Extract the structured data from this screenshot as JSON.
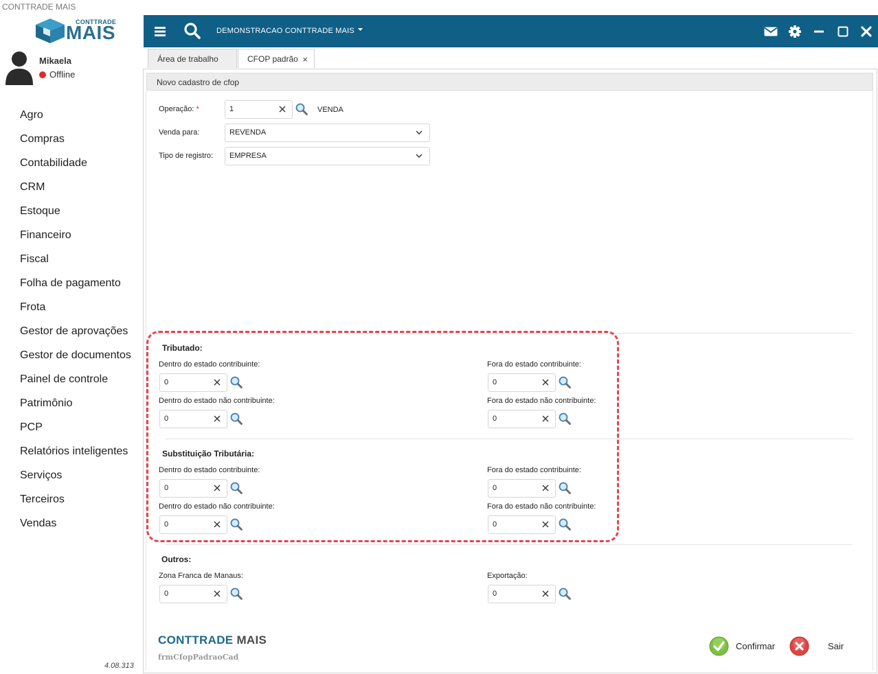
{
  "window": {
    "title": "CONTTRADE MAIS"
  },
  "logo": {
    "sup": "CONTTRADE",
    "main": "MAIS"
  },
  "user": {
    "name": "Mikaela",
    "status": "Offline",
    "status_color": "#e02a2a"
  },
  "menu": [
    "Agro",
    "Compras",
    "Contabilidade",
    "CRM",
    "Estoque",
    "Financeiro",
    "Fiscal",
    "Folha de pagamento",
    "Frota",
    "Gestor de aprovações",
    "Gestor de documentos",
    "Painel de controle",
    "Patrimônio",
    "PCP",
    "Relatórios inteligentes",
    "Serviços",
    "Terceiros",
    "Vendas"
  ],
  "version": "4.08.313",
  "topbar": {
    "company": "DEMONSTRACAO CONTTRADE MAIS",
    "color": "#0f5f86",
    "icons": [
      "menu-icon",
      "search-icon",
      "mail-icon",
      "gear-icon",
      "minimize-icon",
      "maximize-icon",
      "close-icon"
    ]
  },
  "tabs": [
    {
      "label": "Área de trabalho"
    },
    {
      "label": "CFOP padrão",
      "close": "×"
    }
  ],
  "form": {
    "header": "Novo cadastro de cfop",
    "operacao": {
      "label": "Operação:",
      "required": "*",
      "value": "1",
      "desc": "VENDA"
    },
    "venda_para": {
      "label": "Venda para:",
      "value": "REVENDA"
    },
    "tipo_registro": {
      "label": "Tipo de registro:",
      "value": "EMPRESA"
    },
    "tributado": {
      "title": "Tributado:",
      "dentro_contrib": {
        "label": "Dentro do estado contribuinte:",
        "value": "0"
      },
      "fora_contrib": {
        "label": "Fora do estado contribuinte:",
        "value": "0"
      },
      "dentro_nao_contrib": {
        "label": "Dentro do estado não contribuinte:",
        "value": "0"
      },
      "fora_nao_contrib": {
        "label": "Fora do estado não contribuinte:",
        "value": "0"
      }
    },
    "substituicao": {
      "title": "Substituição Tributária:",
      "dentro_contrib": {
        "label": "Dentro do estado contribuinte:",
        "value": "0"
      },
      "fora_contrib": {
        "label": "Fora do estado contribuinte:",
        "value": "0"
      },
      "dentro_nao_contrib": {
        "label": "Dentro do estado não contribuinte:",
        "value": "0"
      },
      "fora_nao_contrib": {
        "label": "Fora do estado não contribuinte:",
        "value": "0"
      }
    },
    "outros": {
      "title": "Outros:",
      "zona_franca": {
        "label": "Zona Franca de Manaus:",
        "value": "0"
      },
      "exportacao": {
        "label": "Exportação:",
        "value": "0"
      }
    }
  },
  "footer": {
    "brand_a": "CONTTRADE",
    "brand_b": "MAIS",
    "form_id": "frmCfopPadraoCad",
    "confirm": "Confirmar",
    "exit": "Sair"
  },
  "colors": {
    "highlight_dash": "#e8434e",
    "accent": "#1d6a8c"
  }
}
